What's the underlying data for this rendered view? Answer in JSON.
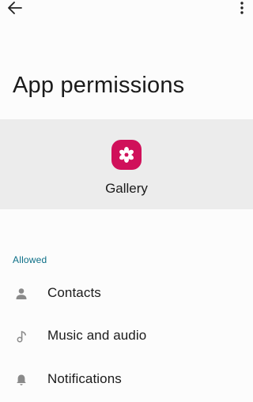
{
  "header": {
    "back_icon": "arrow-back-icon",
    "more_icon": "more-vert-icon"
  },
  "page": {
    "title": "App permissions"
  },
  "app": {
    "name": "Gallery",
    "icon": "gallery-flower-icon",
    "icon_color": "#d0105a"
  },
  "sections": {
    "allowed_label": "Allowed"
  },
  "permissions": [
    {
      "label": "Contacts",
      "icon": "person-icon"
    },
    {
      "label": "Music and audio",
      "icon": "music-note-icon"
    },
    {
      "label": "Notifications",
      "icon": "bell-icon"
    }
  ],
  "colors": {
    "accent": "#0b6e86",
    "header_bg": "#ececec",
    "background": "#fcfcfc"
  }
}
